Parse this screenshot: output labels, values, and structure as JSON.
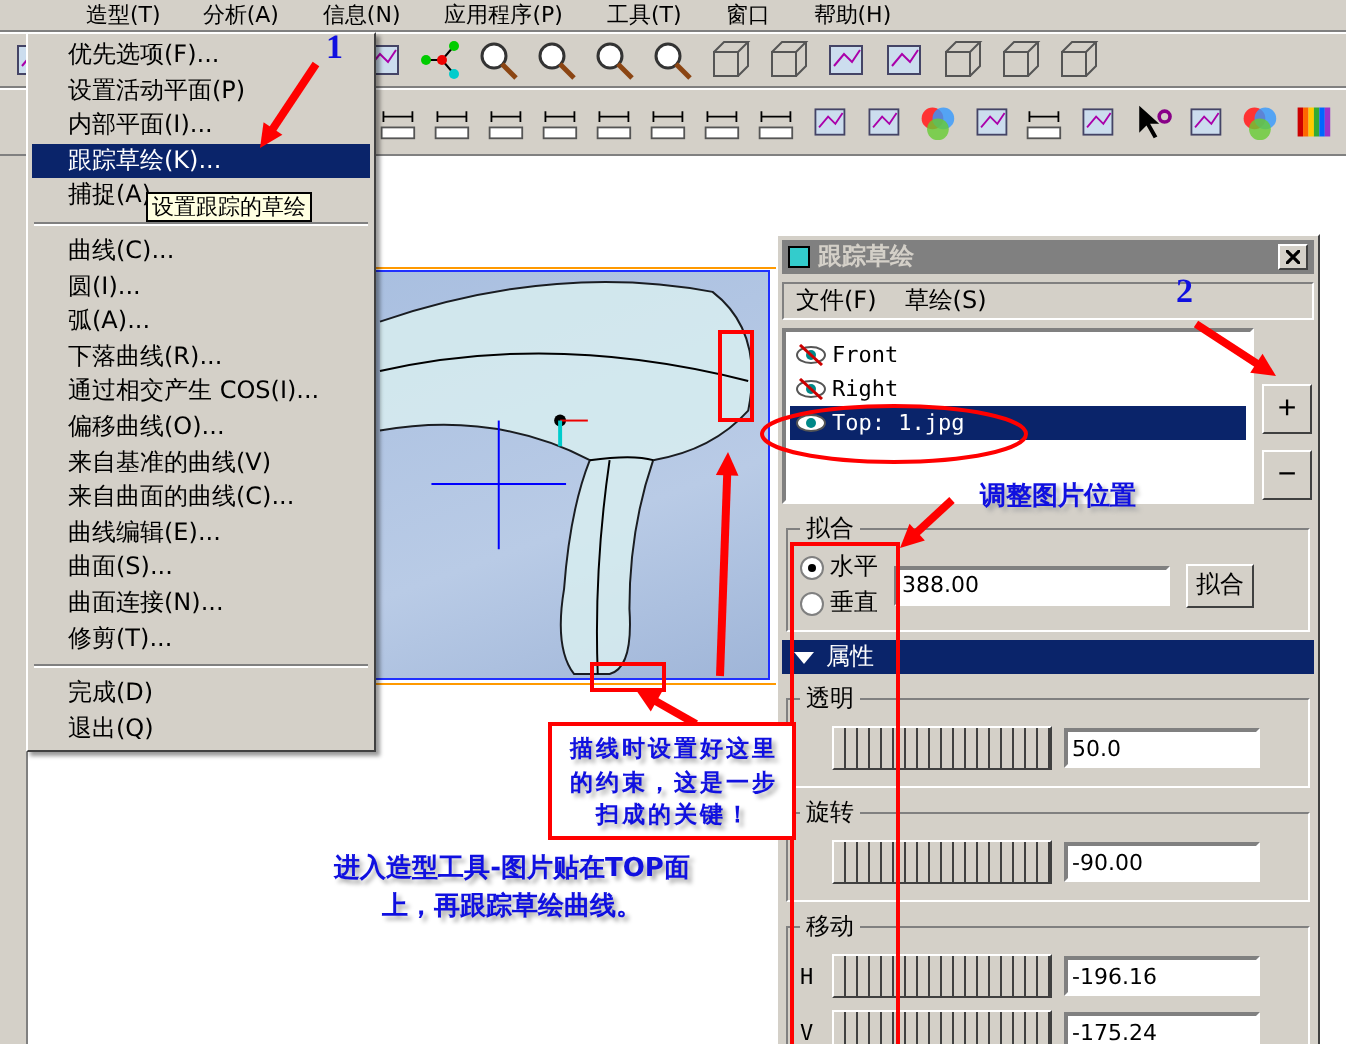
{
  "menubar": [
    {
      "label": "造型(T)",
      "selected": true
    },
    {
      "label": "分析(A)",
      "selected": false
    },
    {
      "label": "信息(N)",
      "selected": false
    },
    {
      "label": "应用程序(P)",
      "selected": false
    },
    {
      "label": "工具(T)",
      "selected": false
    },
    {
      "label": "窗口",
      "selected": false
    },
    {
      "label": "帮助(H)",
      "selected": false
    }
  ],
  "dropdown": {
    "sections": [
      [
        {
          "label": "优先选项(F)...",
          "selected": false
        },
        {
          "label": "设置活动平面(P)",
          "selected": false
        },
        {
          "label": "内部平面(I)...",
          "selected": false
        },
        {
          "label": "跟踪草绘(K)...",
          "selected": true
        },
        {
          "label": "捕捉(A)",
          "selected": false
        }
      ],
      [
        {
          "label": "曲线(C)...",
          "selected": false
        },
        {
          "label": "圆(I)...",
          "selected": false
        },
        {
          "label": "弧(A)...",
          "selected": false
        },
        {
          "label": "下落曲线(R)...",
          "selected": false
        },
        {
          "label": "通过相交产生 COS(I)...",
          "selected": false
        },
        {
          "label": "偏移曲线(O)...",
          "selected": false
        },
        {
          "label": "来自基准的曲线(V)",
          "selected": false
        },
        {
          "label": "来自曲面的曲线(C)...",
          "selected": false
        },
        {
          "label": "曲线编辑(E)...",
          "selected": false
        },
        {
          "label": "曲面(S)...",
          "selected": false
        },
        {
          "label": "曲面连接(N)...",
          "selected": false
        },
        {
          "label": "修剪(T)...",
          "selected": false
        }
      ],
      [
        {
          "label": "完成(D)",
          "selected": false
        },
        {
          "label": "退出(Q)",
          "selected": false
        }
      ]
    ]
  },
  "tooltip": "设置跟踪的草绘",
  "trace_dialog": {
    "title": "跟踪草绘",
    "menu": [
      "文件(F)",
      "草绘(S)"
    ],
    "sketches": [
      {
        "label": "Front",
        "visible": false,
        "selected": false
      },
      {
        "label": "Right",
        "visible": false,
        "selected": false
      },
      {
        "label": "Top: 1.jpg",
        "visible": true,
        "selected": true
      }
    ],
    "add_button": "+",
    "remove_button": "−",
    "fit": {
      "title": "拟合",
      "options": [
        {
          "label": "水平",
          "selected": true
        },
        {
          "label": "垂直",
          "selected": false
        }
      ],
      "value": "388.00",
      "button": "拟合"
    },
    "properties": {
      "title": "属性",
      "expanded": true,
      "groups": [
        {
          "title": "透明",
          "rows": [
            {
              "value": "50.0"
            }
          ]
        },
        {
          "title": "旋转",
          "rows": [
            {
              "value": "-90.00"
            }
          ]
        },
        {
          "title": "移动",
          "rows": [
            {
              "label": "H",
              "value": "-196.16"
            },
            {
              "label": "V",
              "value": "-175.24"
            }
          ]
        }
      ]
    }
  },
  "annotations": {
    "step_1": "1",
    "step_2": "2",
    "adjust_note": "调整图片位置",
    "constraint_note": "描线时设置好这里的约束，这是一步扫成的关键！",
    "intro_note": "进入造型工具-图片贴在TOP面上，再跟踪草绘曲线。"
  }
}
